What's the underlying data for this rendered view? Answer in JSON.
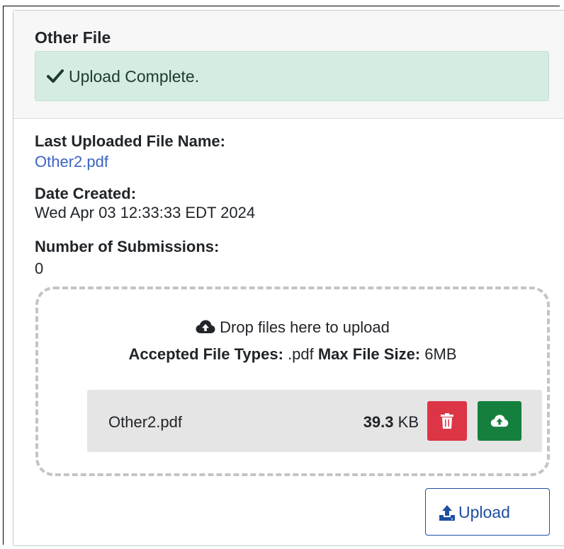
{
  "card": {
    "title": "Other File",
    "alert": {
      "icon": "check-icon",
      "text": "Upload Complete.",
      "color": "#d4ece1"
    }
  },
  "details": {
    "last_uploaded_label": "Last Uploaded File Name:",
    "last_uploaded_value": "Other2.pdf",
    "date_created_label": "Date Created:",
    "date_created_value": "Wed Apr 03 12:33:33 EDT 2024",
    "submissions_label": "Number of Submissions:",
    "submissions_value": "0"
  },
  "dropzone": {
    "icon": "cloud-upload-icon",
    "message": "Drop files here to upload",
    "accepted_label": "Accepted File Types:",
    "accepted_value": ".pdf",
    "max_size_label": "Max File Size:",
    "max_size_value": "6MB",
    "file": {
      "name": "Other2.pdf",
      "size_number": "39.3",
      "size_unit": "KB",
      "delete_icon": "trash-icon",
      "delete_color": "#dc3545",
      "upload_icon": "cloud-upload-icon",
      "upload_color": "#15803d"
    }
  },
  "actions": {
    "upload_icon": "upload-icon",
    "upload_label": "Upload",
    "upload_color": "#1f4ea3"
  }
}
